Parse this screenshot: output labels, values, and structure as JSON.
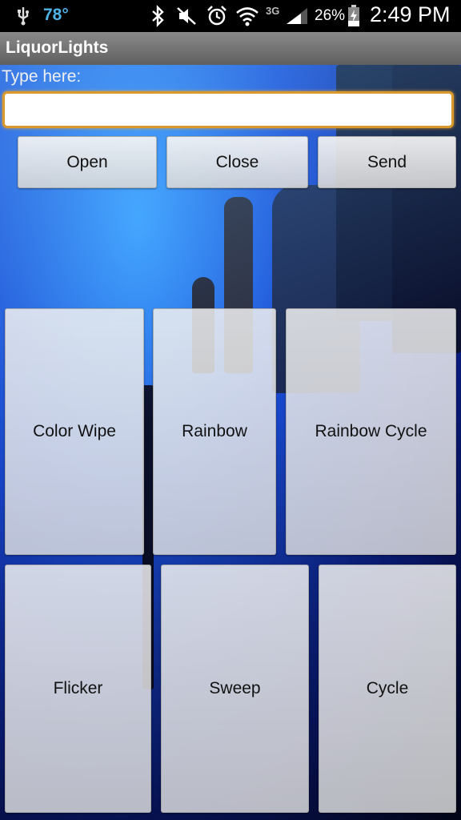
{
  "status_bar": {
    "icons": [
      "usb-icon",
      "bluetooth-icon",
      "mute-icon",
      "alarm-icon",
      "wifi-icon",
      "signal-icon",
      "battery-charging-icon"
    ],
    "temperature": "78°",
    "network": "3G",
    "battery": "26%",
    "time": "2:49 PM"
  },
  "app": {
    "title": "LiquorLights"
  },
  "input": {
    "label": "Type here:",
    "value": "",
    "placeholder": ""
  },
  "actions": {
    "open": "Open",
    "close": "Close",
    "send": "Send"
  },
  "effects": {
    "color_wipe": "Color Wipe",
    "rainbow": "Rainbow",
    "rainbow_cycle": "Rainbow Cycle",
    "flicker": "Flicker",
    "sweep": "Sweep",
    "cycle": "Cycle"
  },
  "colors": {
    "accent": "#d89a2c",
    "temperature": "#4fb3e8",
    "background": "#1a4dd6"
  }
}
